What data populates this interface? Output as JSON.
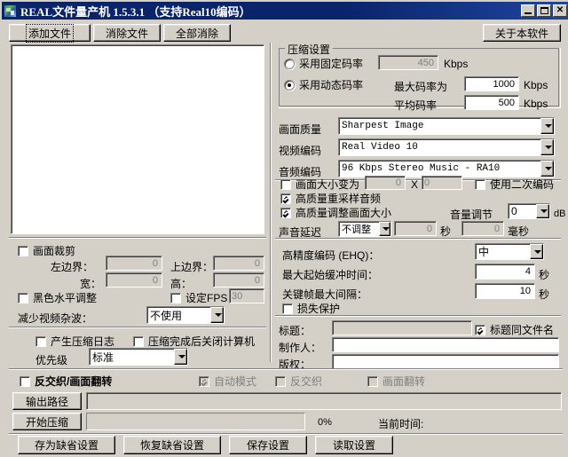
{
  "window": {
    "title": "REAL文件量产机  1.5.3.1 （支持Real10编码）",
    "minimize": "_",
    "maximize": "□",
    "close": "✕"
  },
  "toolbar": {
    "add_file": "添加文件",
    "remove_file": "消除文件",
    "remove_all": "全部消除",
    "about": "关于本软件"
  },
  "file_list": {
    "items": []
  },
  "crop": {
    "enable_label": "画面裁剪",
    "left_label": "左边界：",
    "left_value": "0",
    "top_label": "上边界：",
    "top_value": "0",
    "width_label": "宽：",
    "width_value": "0",
    "height_label": "高：",
    "height_value": "0",
    "black_level_label": "黑色水平调整",
    "set_fps_label": "设定FPS",
    "fps_value": "30",
    "denoise_label": "减少视频杂波：",
    "denoise_value": "不使用"
  },
  "log": {
    "make_log_label": "产生压缩日志",
    "shutdown_label": "压缩完成后关闭计算机",
    "priority_label": "优先级",
    "priority_value": "标准"
  },
  "compression": {
    "group_title": "压缩设置",
    "fixed_rate_label": "采用固定码率",
    "fixed_rate_value": "450",
    "fixed_rate_unit": "Kbps",
    "dynamic_rate_label": "采用动态码率",
    "max_rate_label": "最大码率为",
    "max_rate_value": "1000",
    "max_rate_unit": "Kbps",
    "avg_rate_label": "平均码率",
    "avg_rate_value": "500",
    "avg_rate_unit": "Kbps"
  },
  "codec": {
    "quality_label": "画面质量",
    "quality_value": "Sharpest Image",
    "video_label": "视频编码",
    "video_value": "Real Video 10",
    "audio_label": "音频编码",
    "audio_value": "96 Kbps Stereo Music - RA10"
  },
  "resize": {
    "resize_label": "画面大小变为",
    "resize_w": "0",
    "resize_x": "X",
    "resize_h": "0",
    "two_pass_label": "使用二次编码",
    "hq_resample_label": "高质量重采样音频",
    "hq_resize_label": "高质量调整画面大小",
    "volume_label": "音量调节",
    "volume_value": "0",
    "volume_unit": "dB",
    "audio_delay_label": "声音延迟",
    "audio_delay_mode": "不调整",
    "audio_delay_sec": "0",
    "audio_delay_sec_unit": "秒",
    "audio_delay_ms": "0",
    "audio_delay_ms_unit": "毫秒"
  },
  "advanced": {
    "ehq_label": "高精度编码 (EHQ)：",
    "ehq_value": "中",
    "buffer_label": "最大起始缓冲时间：",
    "buffer_value": "4",
    "buffer_unit": "秒",
    "keyframe_label": "关键帧最大间隔：",
    "keyframe_value": "10",
    "keyframe_unit": "秒",
    "loss_protect_label": "损失保护"
  },
  "meta": {
    "title_label": "标题：",
    "title_value": "",
    "same_as_filename_label": "标题同文件名",
    "author_label": "制作人：",
    "author_value": "",
    "copyright_label": "版权：",
    "copyright_value": ""
  },
  "deinterlace": {
    "main_label": "反交织/画面翻转",
    "auto_label": "自动模式",
    "deint_label": "反交织",
    "flip_label": "画面翻转"
  },
  "output": {
    "path_button": "输出路径",
    "path_value": "",
    "start_button": "开始压缩",
    "progress_text": "",
    "percent": "0%",
    "current_time_label": "当前时间:"
  },
  "bottom_buttons": {
    "save_default": "存为缺省设置",
    "restore_default": "恢复缺省设置",
    "save_settings": "保存设置",
    "load_settings": "读取设置"
  }
}
